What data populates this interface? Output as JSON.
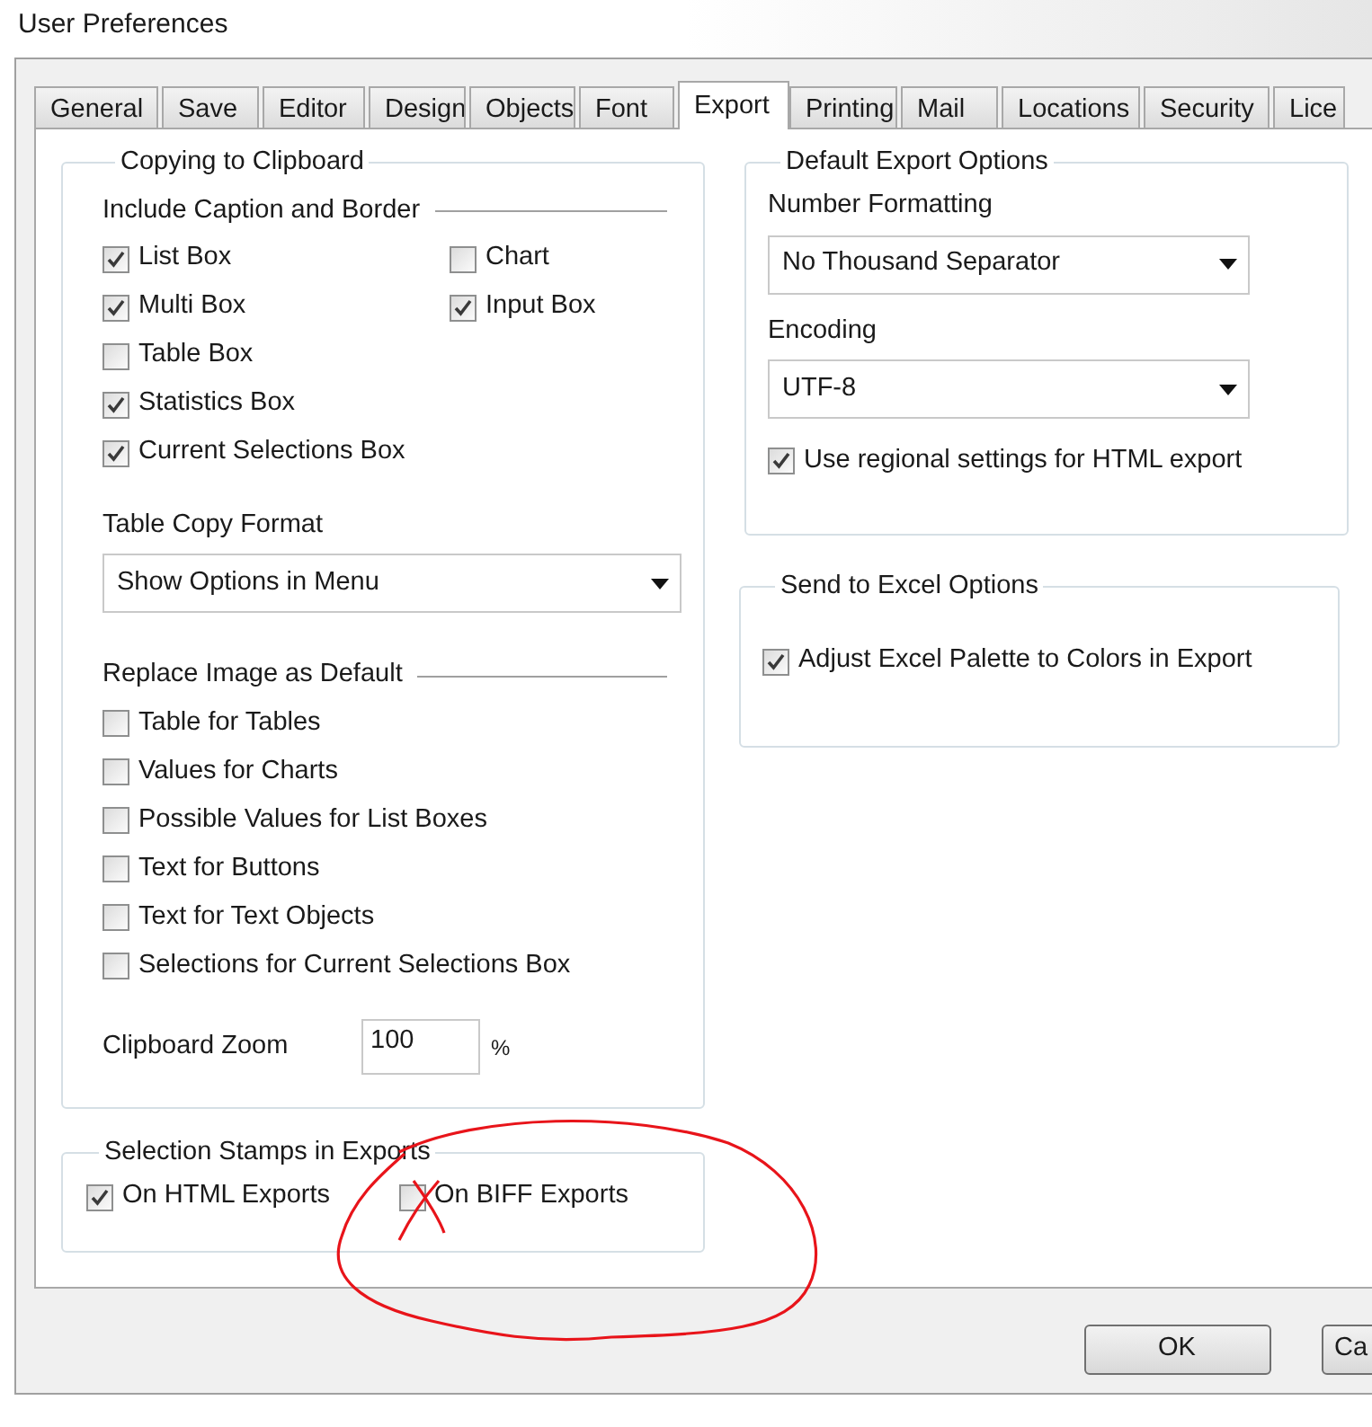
{
  "window": {
    "title": "User Preferences"
  },
  "tabs": [
    {
      "label": "General",
      "selected": false
    },
    {
      "label": "Save",
      "selected": false
    },
    {
      "label": "Editor",
      "selected": false
    },
    {
      "label": "Design",
      "selected": false
    },
    {
      "label": "Objects",
      "selected": false
    },
    {
      "label": "Font",
      "selected": false
    },
    {
      "label": "Export",
      "selected": true
    },
    {
      "label": "Printing",
      "selected": false
    },
    {
      "label": "Mail",
      "selected": false
    },
    {
      "label": "Locations",
      "selected": false
    },
    {
      "label": "Security",
      "selected": false
    },
    {
      "label": "Lice",
      "selected": false
    }
  ],
  "copying_to_clipboard": {
    "title": "Copying to Clipboard",
    "include_caption_and_border": {
      "label": "Include Caption and Border",
      "column_1": [
        {
          "label": "List Box",
          "checked": true
        },
        {
          "label": "Multi Box",
          "checked": true
        },
        {
          "label": "Table Box",
          "checked": false
        },
        {
          "label": "Statistics Box",
          "checked": true
        },
        {
          "label": "Current Selections Box",
          "checked": true
        }
      ],
      "column_2": [
        {
          "label": "Chart",
          "checked": false
        },
        {
          "label": "Input Box",
          "checked": true
        }
      ]
    },
    "table_copy_format": {
      "label": "Table Copy Format",
      "value": "Show Options in Menu"
    },
    "replace_image_as_default": {
      "label": "Replace Image as Default",
      "items": [
        {
          "label": "Table for Tables",
          "checked": false
        },
        {
          "label": "Values for Charts",
          "checked": false
        },
        {
          "label": "Possible Values for List Boxes",
          "checked": false
        },
        {
          "label": "Text for Buttons",
          "checked": false
        },
        {
          "label": "Text for Text Objects",
          "checked": false
        },
        {
          "label": "Selections for Current Selections Box",
          "checked": false
        }
      ]
    },
    "clipboard_zoom": {
      "label": "Clipboard Zoom",
      "value": "100",
      "unit": "%"
    }
  },
  "selection_stamps": {
    "title": "Selection Stamps in Exports",
    "items": [
      {
        "label": "On HTML Exports",
        "checked": true
      },
      {
        "label": "On BIFF Exports",
        "checked": false
      }
    ]
  },
  "default_export_options": {
    "title": "Default Export Options",
    "number_formatting": {
      "label": "Number Formatting",
      "value": "No Thousand Separator"
    },
    "encoding": {
      "label": "Encoding",
      "value": "UTF-8"
    },
    "regional": {
      "label": "Use regional settings for HTML export",
      "checked": true
    }
  },
  "send_to_excel": {
    "title": "Send to Excel Options",
    "adjust_palette": {
      "label": "Adjust Excel Palette to Colors in Export",
      "checked": true
    }
  },
  "buttons": [
    {
      "label": "OK"
    },
    {
      "label": "Ca"
    }
  ]
}
